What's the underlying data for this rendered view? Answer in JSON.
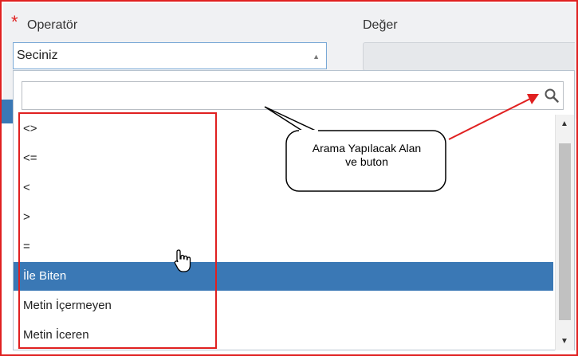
{
  "form": {
    "required_marker": "*",
    "operator_label": "Operatör",
    "value_label": "Değer",
    "operator_select_value": "Seciniz"
  },
  "dropdown": {
    "search_value": "",
    "options": [
      {
        "label": "<>",
        "selected": false
      },
      {
        "label": "<=",
        "selected": false
      },
      {
        "label": "<",
        "selected": false
      },
      {
        "label": ">",
        "selected": false
      },
      {
        "label": "=",
        "selected": false
      },
      {
        "label": "İle Biten",
        "selected": true
      },
      {
        "label": "Metin İçermeyen",
        "selected": false
      },
      {
        "label": "Metin İceren",
        "selected": false
      }
    ]
  },
  "annotation": {
    "callout_line1": "Arama Yapılacak Alan",
    "callout_line2": "ve buton"
  },
  "colors": {
    "required_red": "#e02020",
    "annotation_red": "#e02020",
    "selected_blue": "#3a78b5"
  },
  "icons": {
    "search": "search-icon",
    "select_arrow": "triangle-up-icon",
    "scroll_up": "triangle-up-icon",
    "scroll_down": "triangle-down-icon",
    "cursor": "hand-pointer-icon"
  }
}
